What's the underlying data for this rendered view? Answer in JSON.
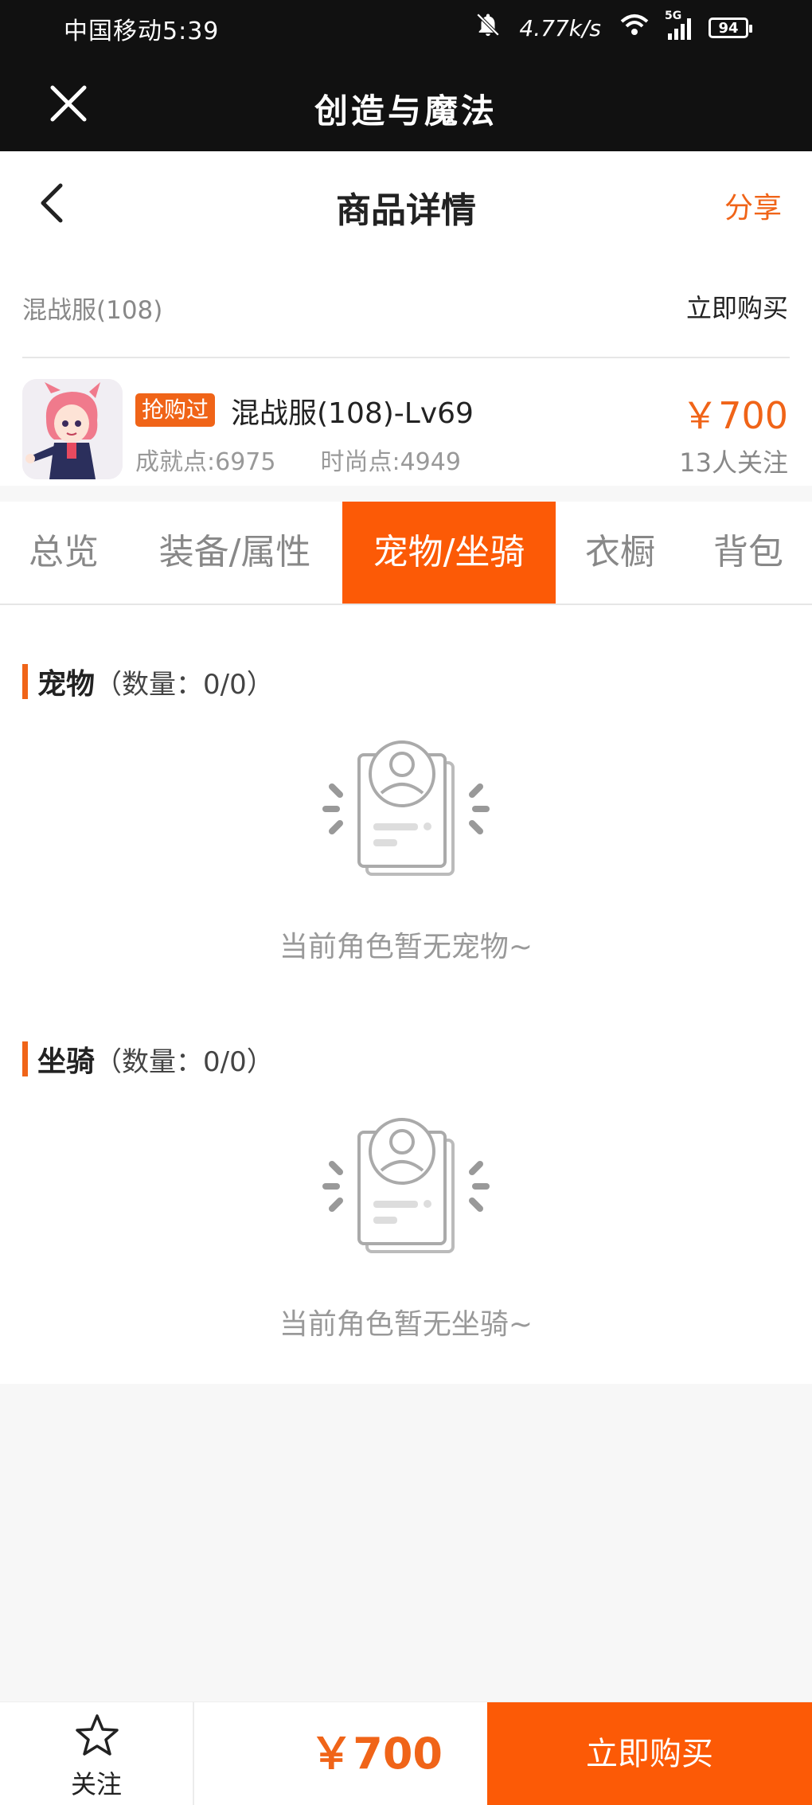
{
  "status_bar": {
    "carrier_time": "中国移动5:39",
    "net_speed": "4.77k/s",
    "network_type": "5G",
    "battery": "94"
  },
  "title_bar": {
    "title": "创造与魔法"
  },
  "page_header": {
    "title": "商品详情",
    "share_label": "分享"
  },
  "server_row": {
    "server_name": "混战服(108)",
    "buy_label": "立即购买"
  },
  "product": {
    "tag": "抢购过",
    "title": "混战服(108)-Lv69",
    "achievement": "成就点:6975",
    "fashion": "时尚点:4949",
    "price": "￥700",
    "followers": "13人关注"
  },
  "tabs": [
    {
      "label": "总览",
      "active": false
    },
    {
      "label": "装备/属性",
      "active": false
    },
    {
      "label": "宠物/坐骑",
      "active": true
    },
    {
      "label": "衣橱",
      "active": false
    },
    {
      "label": "背包",
      "active": false
    }
  ],
  "sections": {
    "pets": {
      "name": "宠物",
      "count": "（数量：0/0）",
      "empty_text": "当前角色暂无宠物~"
    },
    "mounts": {
      "name": "坐骑",
      "count": "（数量：0/0）",
      "empty_text": "当前角色暂无坐骑~"
    }
  },
  "bottom_bar": {
    "follow_label": "关注",
    "price": "￥700",
    "buy_label": "立即购买"
  },
  "colors": {
    "accent": "#fc5a06",
    "accent_text": "#f06418",
    "title_bar_bg": "#111111"
  },
  "icons": [
    "bell-off-icon",
    "wifi-icon",
    "signal-icon",
    "battery-icon",
    "close-icon",
    "chevron-left-icon",
    "empty-profile-card-icon",
    "star-icon"
  ]
}
